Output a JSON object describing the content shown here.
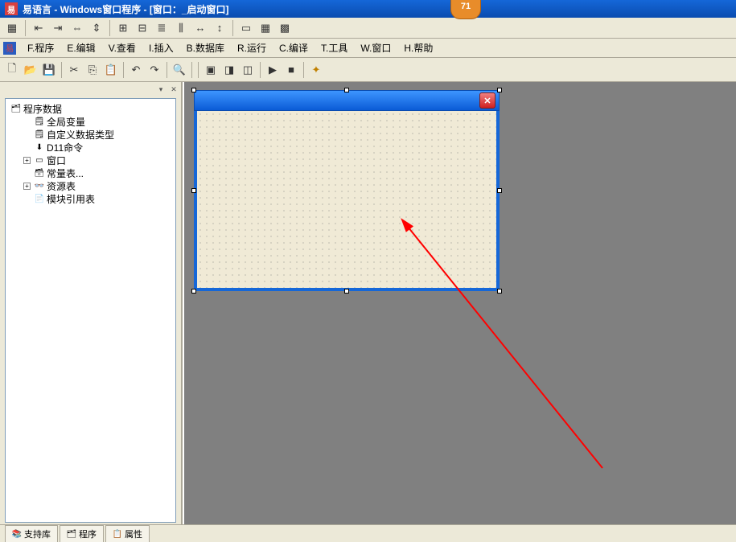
{
  "title": "易语言 - Windows窗口程序 - [窗口：_启动窗口]",
  "badge": "71",
  "menus": {
    "program": "F.程序",
    "edit": "E.编辑",
    "view": "V.查看",
    "insert": "I.插入",
    "database": "B.数据库",
    "run": "R.运行",
    "compile": "C.编译",
    "tools": "T.工具",
    "window": "W.窗口",
    "help": "H.帮助"
  },
  "tree": {
    "root": "程序数据",
    "items": [
      "全局变量",
      "自定义数据类型",
      "D11命令",
      "窗口",
      "常量表...",
      "资源表",
      "模块引用表"
    ]
  },
  "bottom_tabs": {
    "support": "支持库",
    "program": "程序",
    "property": "属性"
  }
}
